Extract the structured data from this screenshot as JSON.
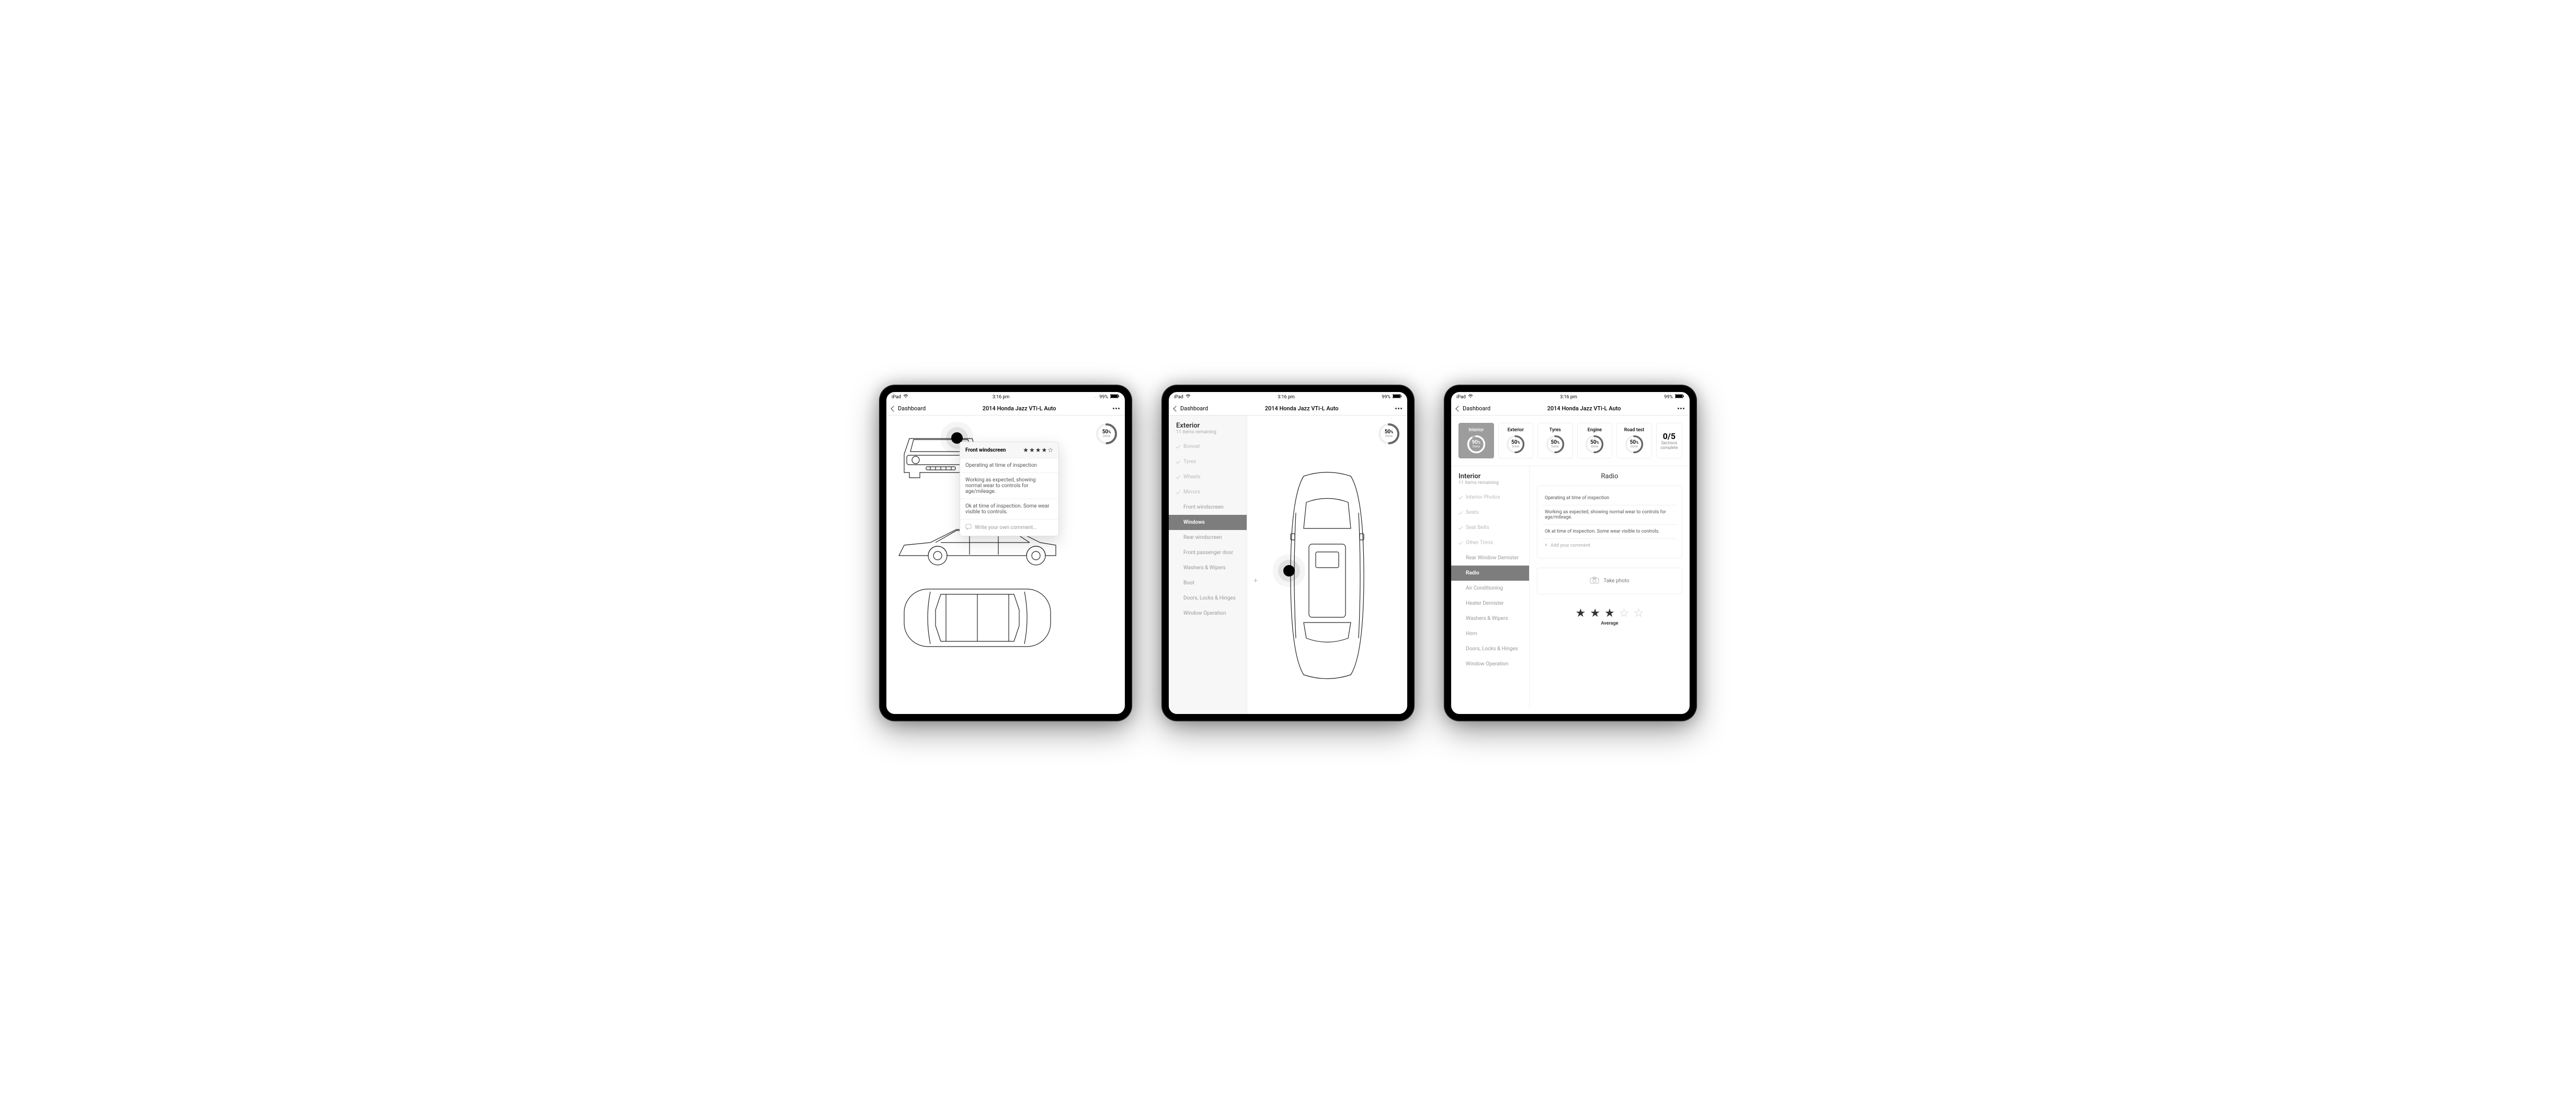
{
  "status": {
    "carrier": "iPad",
    "time": "3:16 pm",
    "battery": "99%"
  },
  "nav": {
    "back": "Dashboard",
    "title": "2014 Honda Jazz VTi-L Auto"
  },
  "screen1": {
    "donut": {
      "percent": "50",
      "pct_suffix": "%",
      "sub": "Done"
    },
    "hotspot_label": "Front\nwindscreen",
    "popover": {
      "title": "Front windscreen",
      "stars": 4,
      "options": [
        "Operating at time of inspection",
        "Working as expected, showing normal wear to controls for age/mileage.",
        "Ok at time of inspection. Some wear visible to controls."
      ],
      "comment_placeholder": "Write your own comment..."
    }
  },
  "screen2": {
    "sidebar_title": "Exterior",
    "sidebar_sub": "11 items remaining",
    "items": [
      {
        "label": "Bonnet",
        "checked": true
      },
      {
        "label": "Tyres",
        "checked": true
      },
      {
        "label": "Wheels",
        "checked": true
      },
      {
        "label": "Mirrors",
        "checked": true
      },
      {
        "label": "Front windscreen",
        "checked": false
      },
      {
        "label": "Windows",
        "checked": false,
        "active": true
      },
      {
        "label": "Rear windscreen",
        "checked": false
      },
      {
        "label": "Front passenger door",
        "checked": false
      },
      {
        "label": "Washers & Wipers",
        "checked": false
      },
      {
        "label": "Boot",
        "checked": false
      },
      {
        "label": "Doors, Locks & Hinges",
        "checked": false
      },
      {
        "label": "Window Operation",
        "checked": false
      }
    ],
    "donut": {
      "percent": "50",
      "pct_suffix": "%",
      "sub": "Done"
    }
  },
  "screen3": {
    "tiles": [
      {
        "label": "Interior",
        "percent": "90",
        "active": true
      },
      {
        "label": "Exterior",
        "percent": "50"
      },
      {
        "label": "Tyres",
        "percent": "50"
      },
      {
        "label": "Engine",
        "percent": "50"
      },
      {
        "label": "Road test",
        "percent": "50"
      }
    ],
    "sections": {
      "count": "0/5",
      "label": "Sections complete"
    },
    "sidebar_title": "Interior",
    "sidebar_sub": "11 items remaining",
    "items": [
      {
        "label": "Interior Photos",
        "checked": true
      },
      {
        "label": "Seats",
        "checked": true
      },
      {
        "label": "Seat Belts",
        "checked": true
      },
      {
        "label": "Other Trims",
        "checked": true
      },
      {
        "label": "Rear Window Demister",
        "checked": false
      },
      {
        "label": "Radio",
        "checked": false,
        "active": true
      },
      {
        "label": "Air Conditioning",
        "checked": false
      },
      {
        "label": "Heater Demister",
        "checked": false
      },
      {
        "label": "Washers & Wipers",
        "checked": false
      },
      {
        "label": "Horn",
        "checked": false
      },
      {
        "label": "Doors, Locks & Hinges",
        "checked": false
      },
      {
        "label": "Window Operation",
        "checked": false
      }
    ],
    "detail": {
      "title": "Radio",
      "options": [
        "Operating at time of inspection",
        "Working as expected, showing normal wear to controls for age/mileage.",
        "Ok at time of inspection. Some wear visible to controls."
      ],
      "add_comment": "Add your comment",
      "photo_label": "Take photo",
      "stars": 3,
      "rating_label": "Average"
    }
  }
}
